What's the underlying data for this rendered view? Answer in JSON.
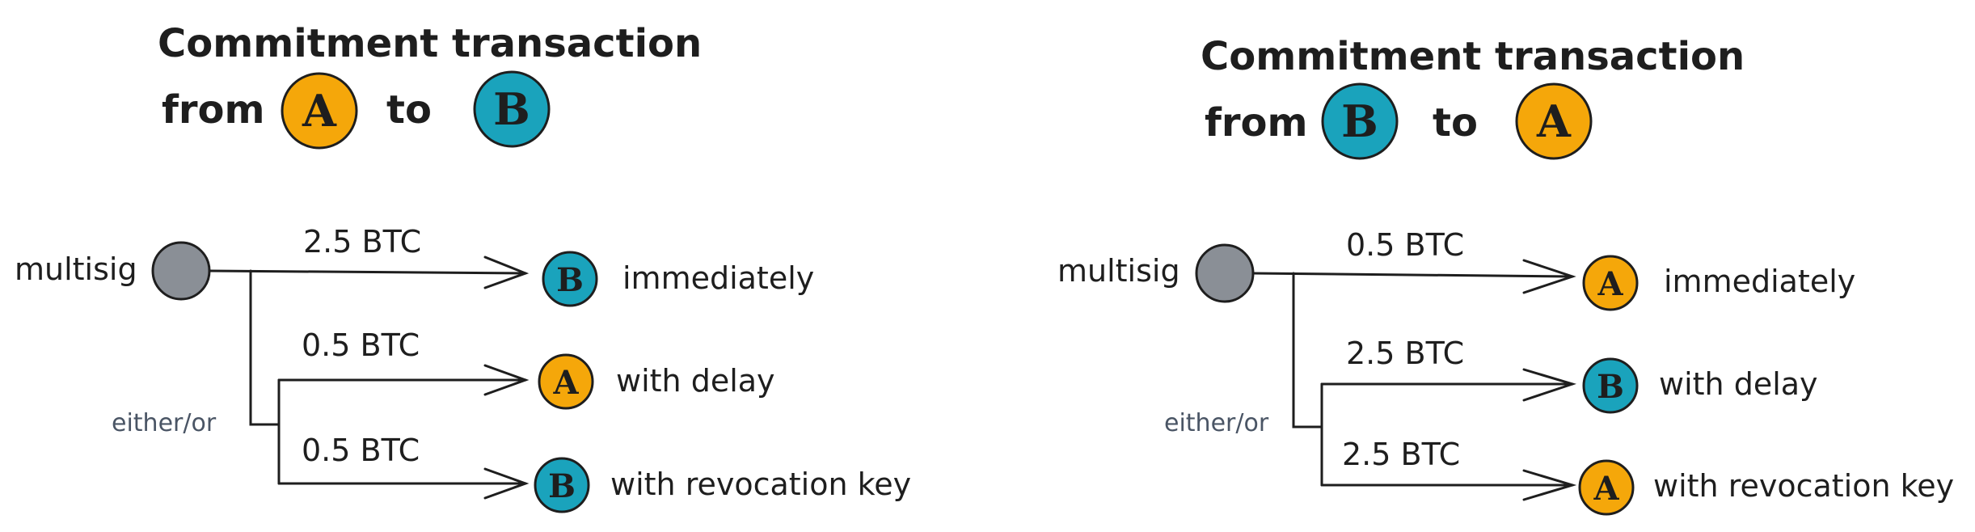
{
  "colors": {
    "party_a": "#f5a70a",
    "party_b": "#1aa3bc",
    "multisig": "#8a8f96",
    "ink": "#1e1e1e",
    "muted": "#4a5565"
  },
  "left": {
    "title_line1": "Commitment transaction",
    "title_from": "from",
    "title_to": "to",
    "title_party_from": "A",
    "title_party_to": "B",
    "source_label": "multisig",
    "branch_label": "either/or",
    "outputs": [
      {
        "amount": "2.5 BTC",
        "party": "B",
        "description": "immediately"
      },
      {
        "amount": "0.5 BTC",
        "party": "A",
        "description": "with delay"
      },
      {
        "amount": "0.5 BTC",
        "party": "B",
        "description": "with revocation key"
      }
    ]
  },
  "right": {
    "title_line1": "Commitment transaction",
    "title_from": "from",
    "title_to": "to",
    "title_party_from": "B",
    "title_party_to": "A",
    "source_label": "multisig",
    "branch_label": "either/or",
    "outputs": [
      {
        "amount": "0.5 BTC",
        "party": "A",
        "description": "immediately"
      },
      {
        "amount": "2.5 BTC",
        "party": "B",
        "description": "with delay"
      },
      {
        "amount": "2.5 BTC",
        "party": "A",
        "description": "with revocation key"
      }
    ]
  }
}
